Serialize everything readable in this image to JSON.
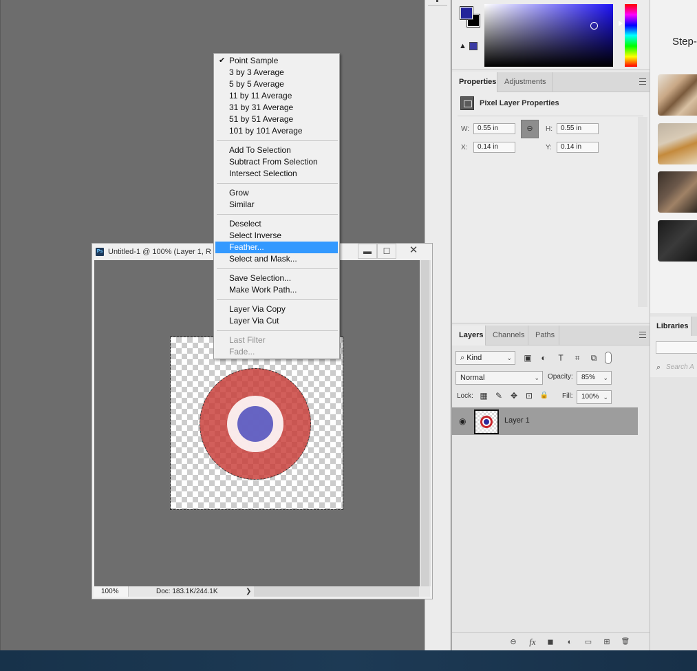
{
  "document": {
    "title": "Untitled-1 @ 100% (Layer 1, R",
    "zoom": "100%",
    "doc_info": "Doc: 183.1K/244.1K",
    "status_arrow": "❯",
    "icon_text": "Ps"
  },
  "window_controls": {
    "minimize": "▬",
    "maximize": "☐",
    "close": "✕"
  },
  "context_menu": {
    "group1": [
      {
        "label": "Point Sample",
        "checked": true
      },
      {
        "label": "3 by 3 Average"
      },
      {
        "label": "5 by 5 Average"
      },
      {
        "label": "11 by 11 Average"
      },
      {
        "label": "31 by 31 Average"
      },
      {
        "label": "51 by 51 Average"
      },
      {
        "label": "101 by 101 Average"
      }
    ],
    "group2": [
      {
        "label": "Add To Selection"
      },
      {
        "label": "Subtract From Selection"
      },
      {
        "label": "Intersect Selection"
      }
    ],
    "group3": [
      {
        "label": "Grow"
      },
      {
        "label": "Similar"
      }
    ],
    "group4": [
      {
        "label": "Deselect"
      },
      {
        "label": "Select Inverse"
      },
      {
        "label": "Feather...",
        "highlighted": true
      },
      {
        "label": "Select and Mask..."
      }
    ],
    "group5": [
      {
        "label": "Save Selection..."
      },
      {
        "label": "Make Work Path..."
      }
    ],
    "group6": [
      {
        "label": "Layer Via Copy"
      },
      {
        "label": "Layer Via Cut"
      }
    ],
    "group7": [
      {
        "label": "Last Filter",
        "disabled": true
      },
      {
        "label": "Fade...",
        "disabled": true
      }
    ],
    "check_glyph": "✔"
  },
  "color_panel": {
    "foreground": "#23249a",
    "background": "#000000",
    "warning_glyph": "▲"
  },
  "properties_panel": {
    "tabs": [
      "Properties",
      "Adjustments"
    ],
    "header": "Pixel Layer Properties",
    "w_label": "W:",
    "w_value": "0.55 in",
    "h_label": "H:",
    "h_value": "0.55 in",
    "x_label": "X:",
    "x_value": "0.14 in",
    "y_label": "Y:",
    "y_value": "0.14 in",
    "link_glyph": "⊖"
  },
  "layers_panel": {
    "tabs": [
      "Layers",
      "Channels",
      "Paths"
    ],
    "filter_kind": "⌕ Kind",
    "blend_mode": "Normal",
    "opacity_label": "Opacity:",
    "opacity_value": "85%",
    "lock_label": "Lock:",
    "fill_label": "Fill:",
    "fill_value": "100%",
    "caret": "⌄",
    "layer_name": "Layer 1",
    "eye_glyph": "◉",
    "filter_icons": [
      "▣",
      "◐",
      "T",
      "⌗",
      "⧉"
    ],
    "lock_icons": [
      "▦",
      "✎",
      "✥",
      "⊡",
      "🔒"
    ],
    "footer_icons": [
      "⊖",
      "fx",
      "◼",
      "◐",
      "▭",
      "⊞",
      "🗑"
    ]
  },
  "learn_panel": {
    "title": "Step-by"
  },
  "libraries_panel": {
    "tab": "Libraries",
    "search_placeholder": "Search A",
    "search_glyph": "⌕"
  }
}
